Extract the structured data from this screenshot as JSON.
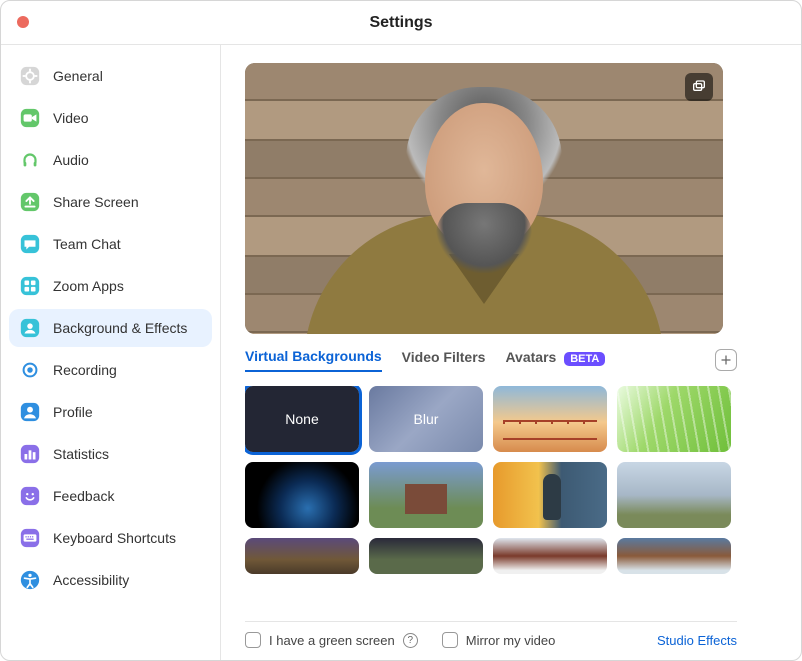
{
  "window": {
    "title": "Settings"
  },
  "sidebar": {
    "items": [
      {
        "label": "General",
        "icon": "gear-icon"
      },
      {
        "label": "Video",
        "icon": "video-icon"
      },
      {
        "label": "Audio",
        "icon": "headphones-icon"
      },
      {
        "label": "Share Screen",
        "icon": "share-screen-icon"
      },
      {
        "label": "Team Chat",
        "icon": "chat-icon"
      },
      {
        "label": "Zoom Apps",
        "icon": "apps-icon"
      },
      {
        "label": "Background & Effects",
        "icon": "background-icon",
        "active": true
      },
      {
        "label": "Recording",
        "icon": "recording-icon"
      },
      {
        "label": "Profile",
        "icon": "profile-icon"
      },
      {
        "label": "Statistics",
        "icon": "statistics-icon"
      },
      {
        "label": "Feedback",
        "icon": "feedback-icon"
      },
      {
        "label": "Keyboard Shortcuts",
        "icon": "keyboard-icon"
      },
      {
        "label": "Accessibility",
        "icon": "accessibility-icon"
      }
    ]
  },
  "tabs": {
    "items": [
      {
        "label": "Virtual Backgrounds",
        "active": true
      },
      {
        "label": "Video Filters"
      },
      {
        "label": "Avatars",
        "badge": "BETA"
      }
    ]
  },
  "backgrounds": {
    "none_label": "None",
    "blur_label": "Blur",
    "selected": "none"
  },
  "footer": {
    "green_screen": "I have a green screen",
    "mirror": "Mirror my video",
    "studio": "Studio Effects"
  }
}
